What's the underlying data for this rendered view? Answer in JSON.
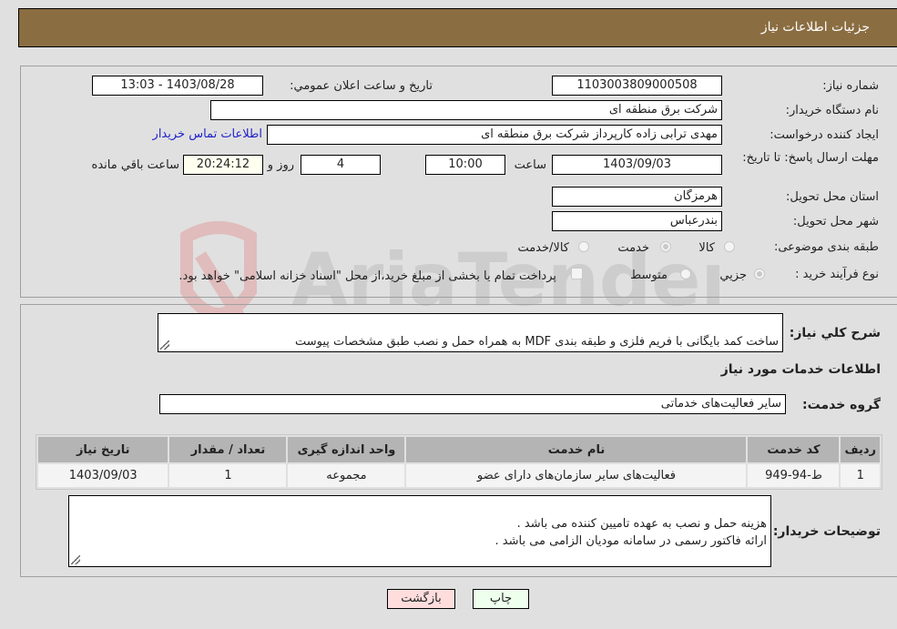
{
  "header": {
    "title": "جزئيات اطلاعات نياز"
  },
  "form": {
    "need_number": {
      "label": "شماره نیاز:",
      "value": "1103003809000508"
    },
    "announce_datetime": {
      "label": "تاريخ و ساعت اعلان عمومي:",
      "value": "1403/08/28 - 13:03"
    },
    "buyer_org": {
      "label": "نام دستگاه خریدار:",
      "value": "شرکت برق منطقه ای"
    },
    "requester": {
      "label": "ایجاد کننده درخواست:",
      "value": "مهدی ترابی زاده کارپرداز شرکت برق منطقه ای",
      "contact_link": "اطلاعات تماس خریدار"
    },
    "deadline": {
      "label": "مهلت ارسال پاسخ: تا تاریخ:",
      "date": "1403/09/03",
      "time_label": "ساعت",
      "time": "10:00",
      "days": "4",
      "days_label": "روز و",
      "remaining": "20:24:12",
      "remaining_label": "ساعت باقي مانده"
    },
    "province": {
      "label": "استان محل تحویل:",
      "value": "هرمزگان"
    },
    "city": {
      "label": "شهر محل تحویل:",
      "value": "بندرعباس"
    },
    "category": {
      "label": "طبقه بندی موضوعی:",
      "options": [
        "کالا",
        "خدمت",
        "کالا/خدمت"
      ],
      "selected": "خدمت"
    },
    "purchase_type": {
      "label": "نوع فرآیند خرید :",
      "options": [
        "جزيي",
        "متوسط"
      ],
      "selected": "جزيي",
      "treasury_note": "پرداخت تمام یا بخشی از مبلغ خرید،از محل \"اسناد خزانه اسلامی\" خواهد بود.",
      "treasury_checked": false
    }
  },
  "details": {
    "description_label": "شرح کلي نياز:",
    "description": "ساخت کمد بایگانی با فریم فلزی و طبقه بندی MDF به همراه حمل و نصب طبق مشخصات پیوست",
    "services_heading": "اطلاعات خدمات مورد نياز",
    "service_group_label": "گروه خدمت:",
    "service_group": "سایر فعالیت‌های خدماتی",
    "table": {
      "headers": [
        "رديف",
        "کد خدمت",
        "نام خدمت",
        "واحد اندازه گيری",
        "تعداد / مقدار",
        "تاريخ نياز"
      ],
      "rows": [
        [
          "1",
          "ط-94-949",
          "فعالیت‌های سایر سازمان‌های دارای عضو",
          "مجموعه",
          "1",
          "1403/09/03"
        ]
      ]
    },
    "buyer_notes_label": "توضيحات خريدار:",
    "buyer_notes": "هزینه حمل و نصب به عهده تامیین کننده می باشد .\nارائه فاکتور رسمی در سامانه مودیان الزامی می باشد ."
  },
  "buttons": {
    "print": "چاپ",
    "back": "بازگشت"
  },
  "colors": {
    "header_bg": "#8b6d42",
    "print_bg": "#eeffee",
    "back_bg": "#ffdddd",
    "link": "#2222cc"
  }
}
